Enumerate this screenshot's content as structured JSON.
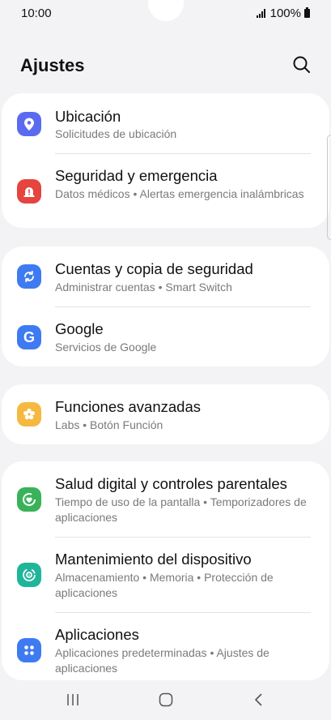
{
  "status_bar": {
    "time": "10:00",
    "battery": "100%"
  },
  "header": {
    "title": "Ajustes"
  },
  "colors": {
    "location": "#5b6bf0",
    "security": "#e5443f",
    "accounts": "#3e7bf2",
    "google": "#3e7bf2",
    "advanced": "#f5b93f",
    "wellbeing": "#3ab25a",
    "maintenance": "#1fb59a",
    "apps": "#3e7bf2"
  },
  "groups": [
    {
      "items": [
        {
          "title": "Ubicación",
          "subtitle": "Solicitudes de ubicación",
          "icon": "location-pin-icon"
        },
        {
          "title": "Seguridad y emergencia",
          "subtitle": "Datos médicos • Alertas emergencia inalámbricas",
          "icon": "emergency-alert-icon"
        }
      ]
    },
    {
      "items": [
        {
          "title": "Cuentas y copia de seguridad",
          "subtitle": "Administrar cuentas • Smart Switch",
          "icon": "sync-arrows-icon"
        },
        {
          "title": "Google",
          "subtitle": "Servicios de Google",
          "icon": "google-g-icon"
        }
      ]
    },
    {
      "items": [
        {
          "title": "Funciones avanzadas",
          "subtitle": "Labs • Botón Función",
          "icon": "gear-flower-icon"
        }
      ]
    },
    {
      "items": [
        {
          "title": "Salud digital y controles parentales",
          "subtitle": "Tiempo de uso de la pantalla • Temporizadores de aplicaciones",
          "icon": "heart-circle-icon"
        },
        {
          "title": "Mantenimiento del dispositivo",
          "subtitle": "Almacenamiento • Memoria • Protección de aplicaciones",
          "icon": "device-care-icon"
        },
        {
          "title": "Aplicaciones",
          "subtitle": "Aplicaciones predeterminadas • Ajustes de aplicaciones",
          "icon": "apps-grid-icon"
        }
      ]
    }
  ],
  "nav_bar": {
    "buttons": [
      "recents-icon",
      "home-icon",
      "back-icon"
    ]
  }
}
